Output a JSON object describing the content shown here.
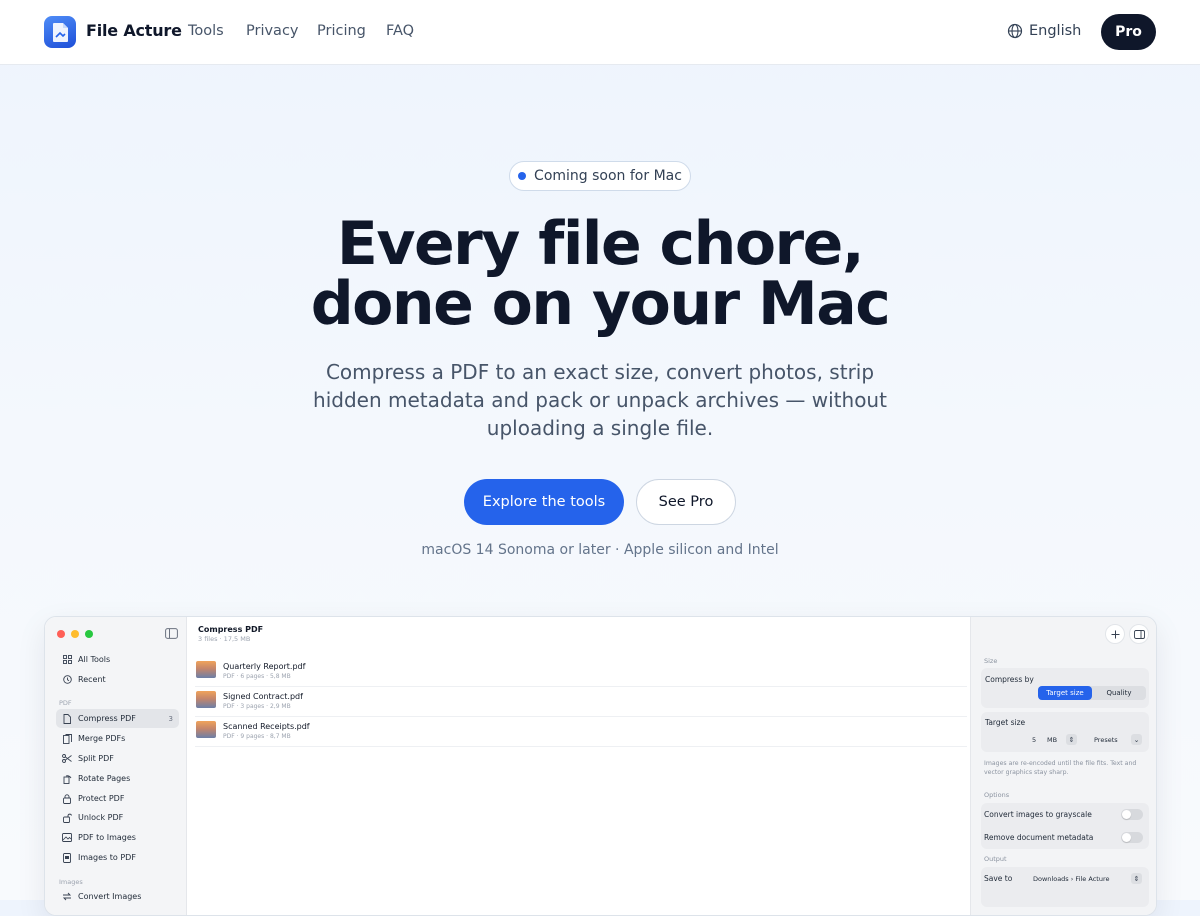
{
  "nav": {
    "brand": "File Acture",
    "links": [
      "Tools",
      "Privacy",
      "Pricing",
      "FAQ"
    ],
    "language": "English",
    "pro_label": "Pro"
  },
  "hero": {
    "badge": "Coming soon for Mac",
    "headline_line1": "Every file chore,",
    "headline_line2": "done on your Mac",
    "subtext": "Compress a PDF to an exact size, convert photos, strip hidden metadata and pack or unpack archives — without uploading a single file.",
    "cta_primary": "Explore the tools",
    "cta_secondary": "See Pro",
    "requirements": "macOS 14 Sonoma or later · Apple silicon and Intel"
  },
  "app": {
    "sidebar": {
      "top_items": [
        {
          "label": "All Tools",
          "icon": "grid-icon"
        },
        {
          "label": "Recent",
          "icon": "clock-icon"
        }
      ],
      "pdf_section": "PDF",
      "pdf_items": [
        {
          "label": "Compress PDF",
          "icon": "doc-icon",
          "count": "3"
        },
        {
          "label": "Merge PDFs",
          "icon": "docs-icon"
        },
        {
          "label": "Split PDF",
          "icon": "scissors-icon"
        },
        {
          "label": "Rotate Pages",
          "icon": "rotate-icon"
        },
        {
          "label": "Protect PDF",
          "icon": "lock-icon"
        },
        {
          "label": "Unlock PDF",
          "icon": "unlock-icon"
        },
        {
          "label": "PDF to Images",
          "icon": "image-icon"
        },
        {
          "label": "Images to PDF",
          "icon": "doc-image-icon"
        }
      ],
      "images_section": "Images",
      "images_items": [
        {
          "label": "Convert Images",
          "icon": "convert-icon"
        }
      ]
    },
    "main": {
      "title": "Compress PDF",
      "subtitle": "3 files · 17,5 MB",
      "files": [
        {
          "name": "Quarterly Report.pdf",
          "meta": "PDF · 6 pages · 5,8 MB"
        },
        {
          "name": "Signed Contract.pdf",
          "meta": "PDF · 3 pages · 2,9 MB"
        },
        {
          "name": "Scanned Receipts.pdf",
          "meta": "PDF · 9 pages · 8,7 MB"
        }
      ]
    },
    "inspector": {
      "size_section": "Size",
      "compress_by": "Compress by",
      "seg_target": "Target size",
      "seg_quality": "Quality",
      "target_size_label": "Target size",
      "target_value": "5",
      "target_unit": "MB",
      "presets": "Presets",
      "hint": "Images are re-encoded until the file fits. Text and vector graphics stay sharp.",
      "options_section": "Options",
      "opt_grayscale": "Convert images to grayscale",
      "opt_metadata": "Remove document metadata",
      "output_section": "Output",
      "save_to_label": "Save to",
      "save_to_value": "Downloads › File Acture"
    }
  }
}
